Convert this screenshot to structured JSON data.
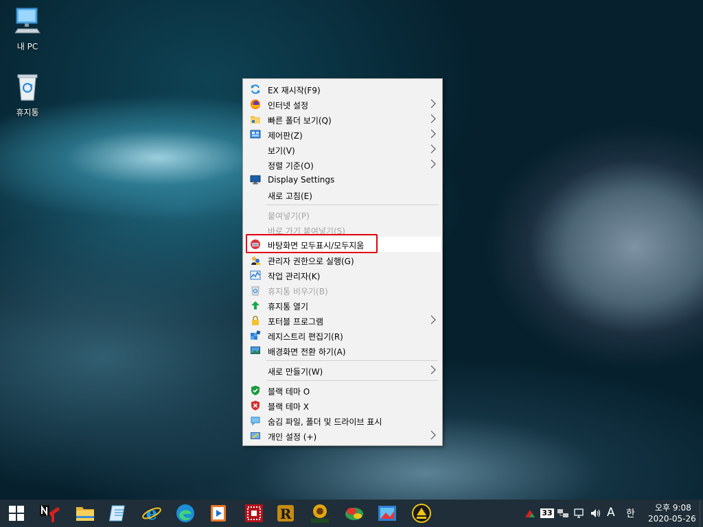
{
  "desktop": {
    "icons": [
      {
        "label": "내 PC",
        "icon": "computer-icon"
      },
      {
        "label": "휴지통",
        "icon": "recycle-bin-icon"
      }
    ]
  },
  "context_menu": {
    "items": [
      {
        "label": "EX 재시작(F9)",
        "icon": "refresh-icon",
        "submenu": false,
        "enabled": true
      },
      {
        "label": "인터넷 설정",
        "icon": "firefox-icon",
        "submenu": true,
        "enabled": true
      },
      {
        "label": "빠른 폴더 보기(Q)",
        "icon": "folder-icon",
        "submenu": true,
        "enabled": true
      },
      {
        "label": "제어판(Z)",
        "icon": "control-panel-icon",
        "submenu": true,
        "enabled": true
      },
      {
        "label": "보기(V)",
        "icon": "",
        "submenu": true,
        "enabled": true
      },
      {
        "label": "정렬 기준(O)",
        "icon": "",
        "submenu": true,
        "enabled": true
      },
      {
        "label": "Display Settings",
        "icon": "monitor-icon",
        "submenu": false,
        "enabled": true
      },
      {
        "label": "새로 고침(E)",
        "icon": "",
        "submenu": false,
        "enabled": true
      },
      {
        "label": "붙여넣기(P)",
        "icon": "",
        "submenu": false,
        "enabled": false
      },
      {
        "label": "바로 가기 붙여넣기(S)",
        "icon": "",
        "submenu": false,
        "enabled": false
      },
      {
        "label": "바탕화면 모두표시/모두지움",
        "icon": "desktop-toggle-icon",
        "submenu": false,
        "enabled": true,
        "highlighted": true
      },
      {
        "label": "관리자 권한으로 실행(G)",
        "icon": "admin-run-icon",
        "submenu": false,
        "enabled": true
      },
      {
        "label": "작업 관리자(K)",
        "icon": "task-manager-icon",
        "submenu": false,
        "enabled": true
      },
      {
        "label": "휴지통 비우기(B)",
        "icon": "empty-bin-icon",
        "submenu": false,
        "enabled": false
      },
      {
        "label": "휴지통 열기",
        "icon": "open-bin-icon",
        "submenu": false,
        "enabled": true
      },
      {
        "label": "포터블 프로그램",
        "icon": "lock-icon",
        "submenu": true,
        "enabled": true
      },
      {
        "label": "레지스트리 편집기(R)",
        "icon": "registry-icon",
        "submenu": false,
        "enabled": true
      },
      {
        "label": "배경화면 전환 하기(A)",
        "icon": "wallpaper-icon",
        "submenu": false,
        "enabled": true
      },
      {
        "label": "새로 만들기(W)",
        "icon": "",
        "submenu": true,
        "enabled": true
      },
      {
        "label": "블랙 테마 O",
        "icon": "shield-check-icon",
        "submenu": false,
        "enabled": true
      },
      {
        "label": "블랙 테마 X",
        "icon": "shield-x-icon",
        "submenu": false,
        "enabled": true
      },
      {
        "label": "숨김 파일, 폴더 및 드라이브 표시",
        "icon": "hidden-files-icon",
        "submenu": false,
        "enabled": true
      },
      {
        "label": "개인 설정 (+)",
        "icon": "personalize-icon",
        "submenu": true,
        "enabled": true
      }
    ]
  },
  "taskbar": {
    "apps": [
      "start-icon",
      "nt-tool-icon",
      "file-explorer-icon",
      "notepad-icon",
      "internet-explorer-icon",
      "edge-icon",
      "media-player-icon",
      "grid-app-icon",
      "r-app-icon",
      "imagine-icon",
      "puzzle-app-icon",
      "screenshot-app-icon",
      "eject-app-icon"
    ],
    "tray": {
      "network_badge": "33",
      "ime_mode": "A",
      "ime_lang": "한",
      "time": "오후 9:08",
      "date": "2020-05-26"
    }
  },
  "colors": {
    "highlight_box": "#e3000f",
    "taskbar_bg": "#1f2e38",
    "menu_bg": "#f2f2f2"
  }
}
